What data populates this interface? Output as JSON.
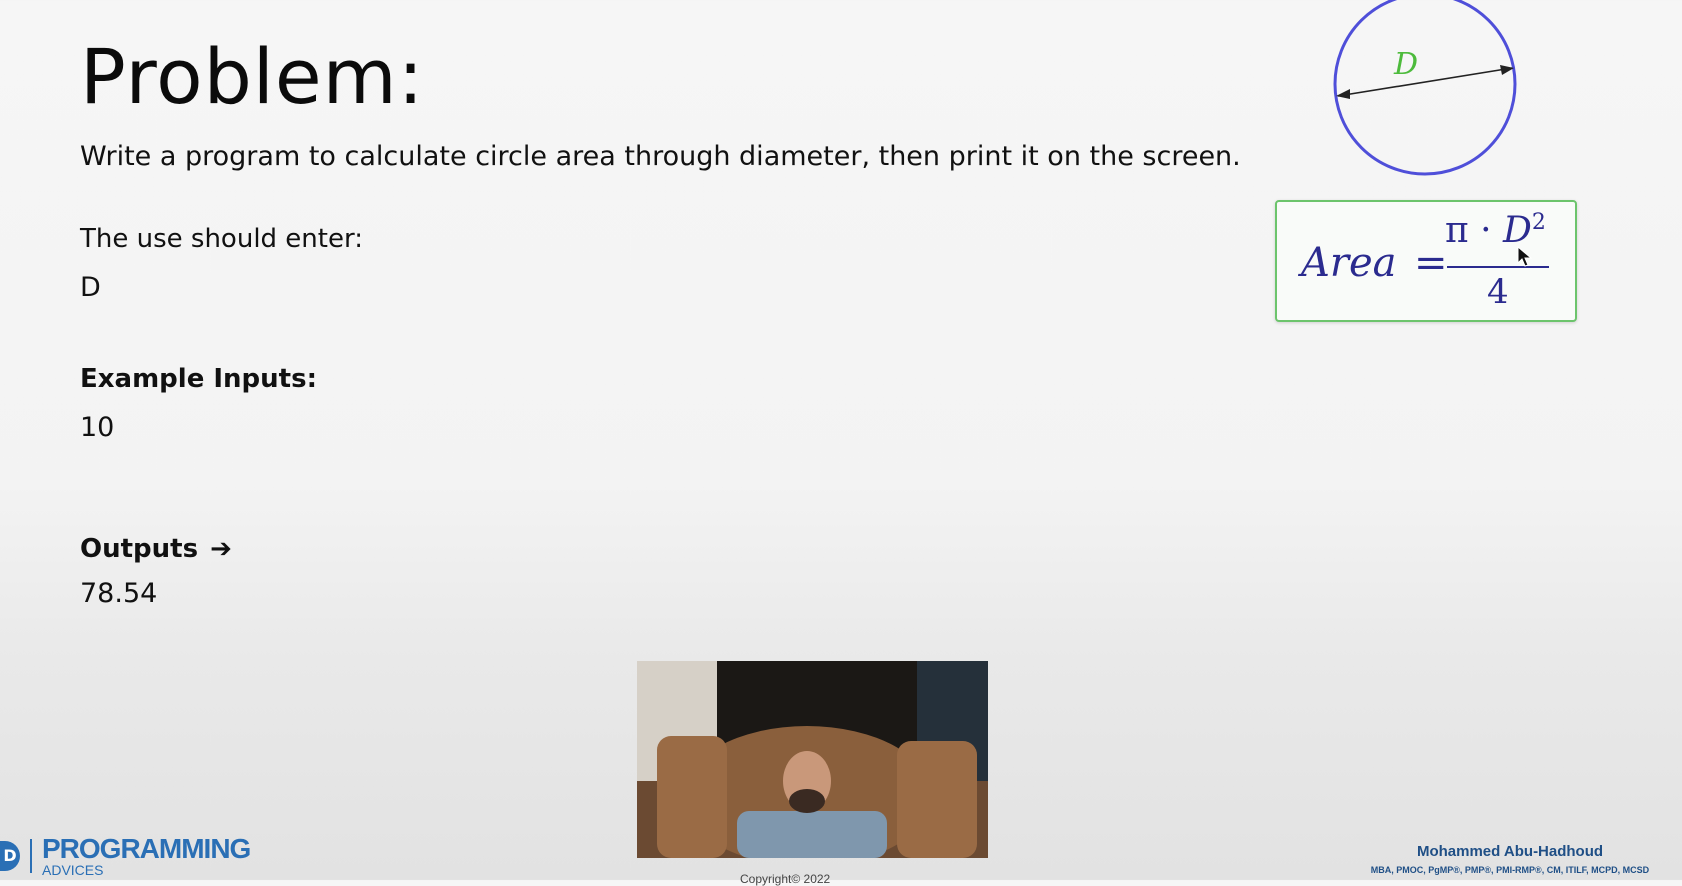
{
  "slide": {
    "title": "Problem:",
    "description": "Write a program to calculate circle area through diameter, then print it on the screen.",
    "user_input_label": "The use should enter:",
    "user_input_value": "D",
    "example_inputs_label": "Example Inputs:",
    "example_inputs_value": "10",
    "outputs_label": "Outputs",
    "outputs_arrow": "➔",
    "outputs_value": "78.54"
  },
  "diagram": {
    "diameter_label": "D",
    "circle_color": "#4f4fd9",
    "label_color": "#4dbb3c"
  },
  "formula": {
    "lhs": "Area",
    "equals": "=",
    "numerator_pi": "π · ",
    "numerator_var": "D",
    "numerator_exp": "2",
    "denominator": "4"
  },
  "footer": {
    "logo_mark": "D",
    "logo_text": "PROGRAMMING",
    "logo_sub": "ADVICES",
    "author_name": "Mohammed Abu-Hadhoud",
    "author_credentials": "MBA, PMOC, PgMP®, PMP®, PMI-RMP®, CM, ITILF, MCPD, MCSD",
    "copyright": "Copyright© 2022"
  }
}
